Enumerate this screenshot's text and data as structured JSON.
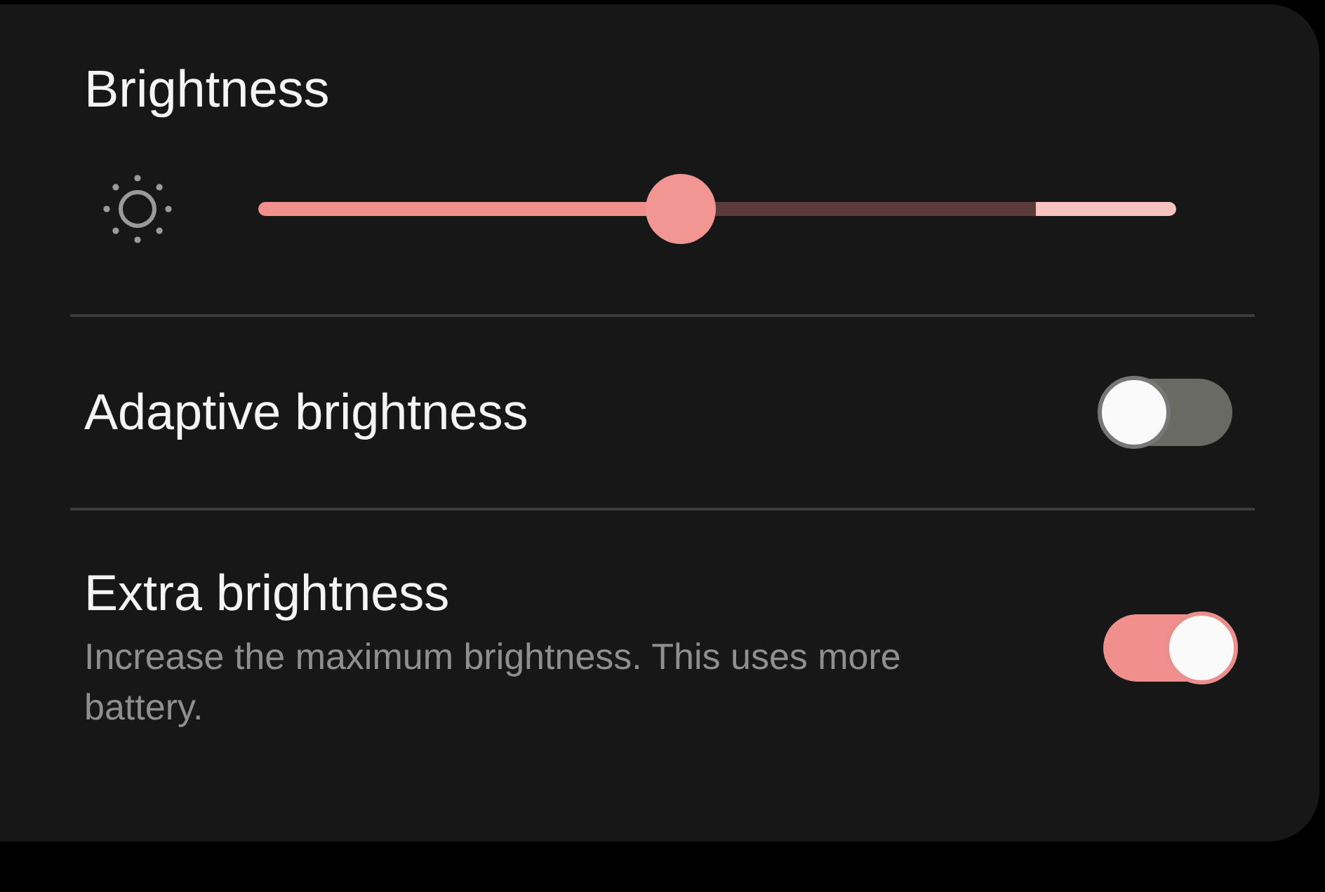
{
  "title": "Brightness",
  "brightness_slider": {
    "level": 0.46
  },
  "settings": [
    {
      "label": "Adaptive brightness",
      "on": false
    },
    {
      "label": "Extra brightness",
      "description": "Increase the maximum brightness. This uses more battery.",
      "on": true
    }
  ]
}
